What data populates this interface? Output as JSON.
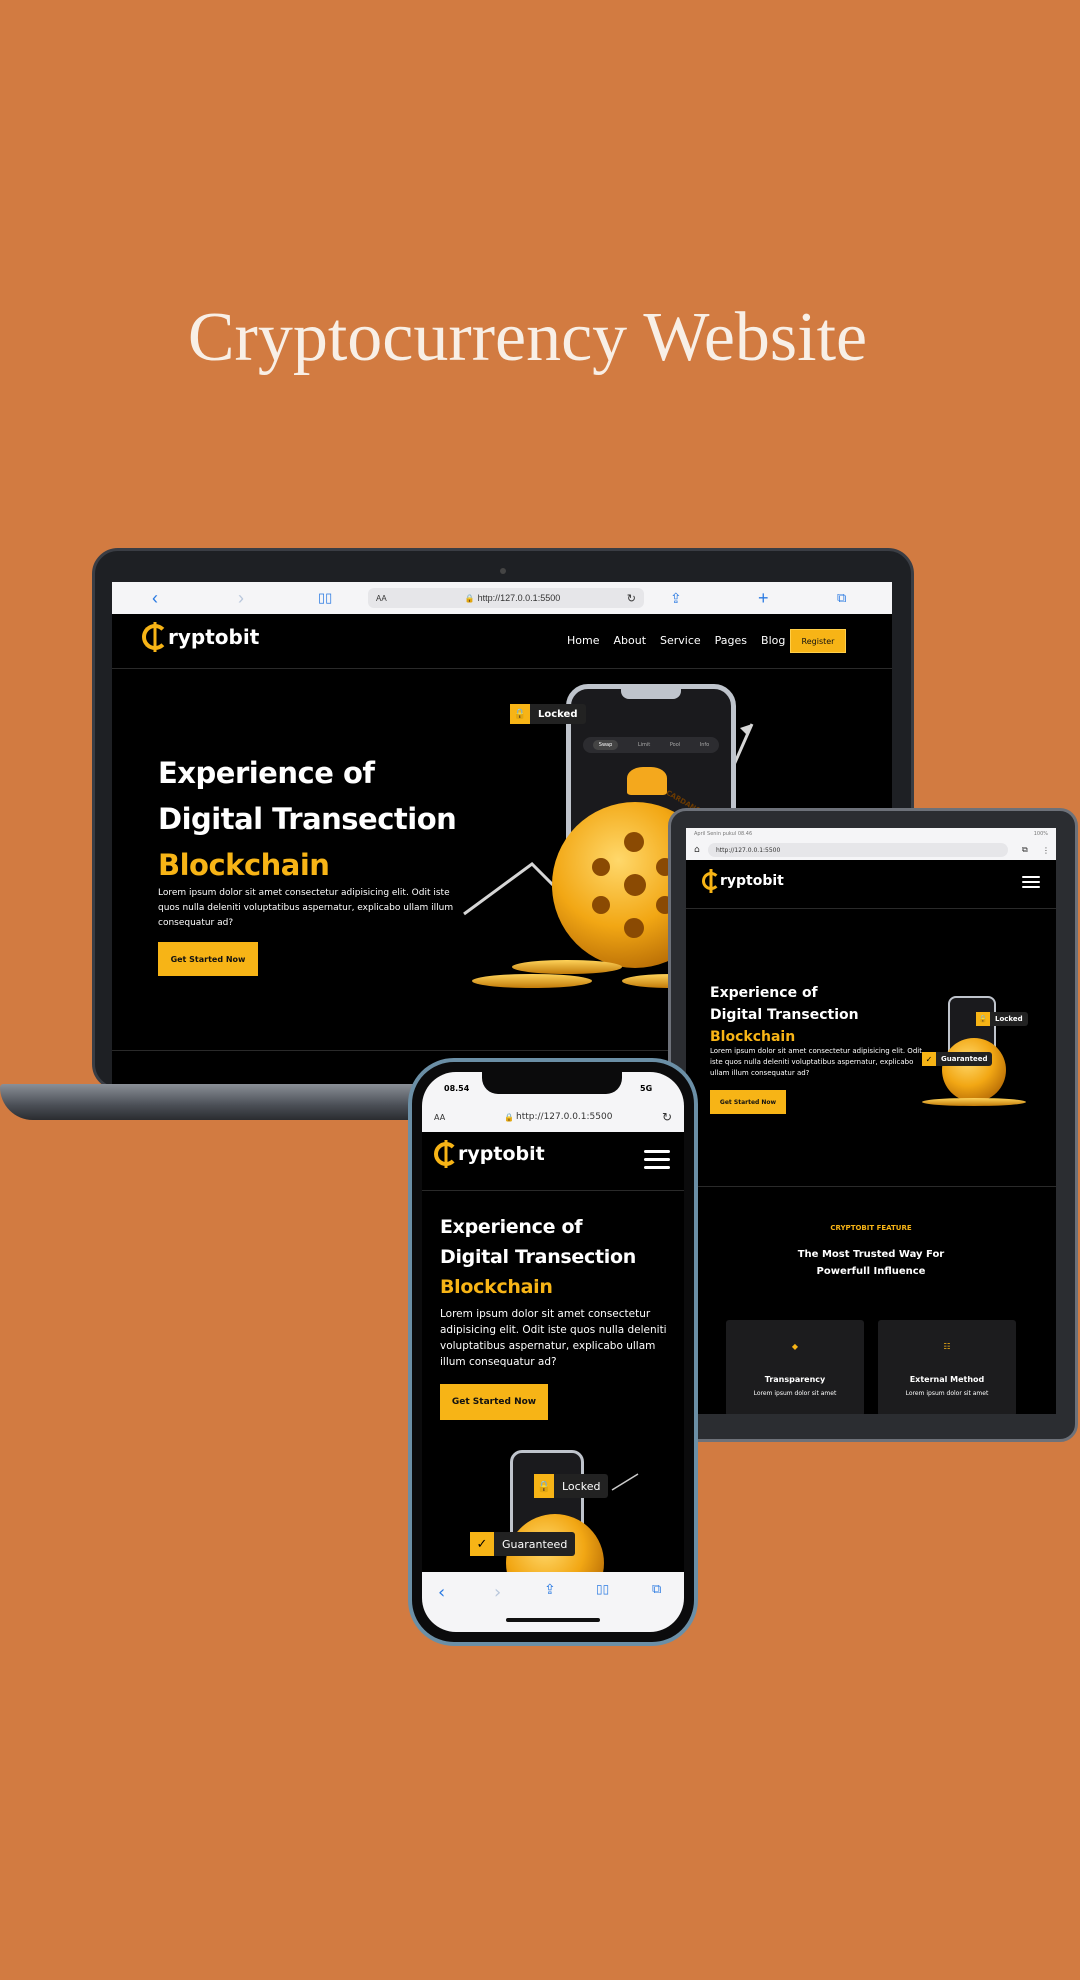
{
  "headline": "Cryptocurrency Website",
  "colors": {
    "background": "#d27b41",
    "accent": "#f7b416",
    "site_bg": "#000000"
  },
  "laptop": {
    "url": "http://127.0.0.1:5500",
    "aa": "AA",
    "nav": [
      "Home",
      "About",
      "Service",
      "Pages",
      "Blog"
    ],
    "register": "Register",
    "hero_line1": "Experience of",
    "hero_line2": "Digital Transection",
    "hero_line3": "Blockchain",
    "hero_text": "Lorem ipsum dolor sit amet consectetur adipisicing elit. Odit iste quos nulla deleniti voluptatibus aspernatur, explicabo ullam illum consequatur ad?",
    "cta": "Get Started Now",
    "locked": "Locked",
    "cardano": "CARDANO",
    "app_tabs": [
      "Swap",
      "Limit",
      "Pool",
      "Info"
    ]
  },
  "logo_text": "ryptobit",
  "tablet": {
    "status_left": "April Senin pukul 08.46",
    "status_right": "100%",
    "url": "http://127.0.0.1:5500",
    "hero_line1": "Experience of",
    "hero_line2": "Digital Transection",
    "hero_line3": "Blockchain",
    "hero_text": "Lorem ipsum dolor sit amet consectetur adipisicing elit. Odit iste quos nulla deleniti voluptatibus aspernatur, explicabo ullam illum consequatur ad?",
    "cta": "Get Started Now",
    "locked": "Locked",
    "guaranteed": "Guaranteed",
    "feature_kicker": "CRYPTOBIT FEATURE",
    "feature_title_1": "The Most Trusted Way For",
    "feature_title_2": "Powerfull Influence",
    "cards": [
      {
        "title": "Transparency",
        "text": "Lorem ipsum dolor sit amet"
      },
      {
        "title": "External Method",
        "text": "Lorem ipsum dolor sit amet"
      }
    ]
  },
  "phone": {
    "time": "08.54",
    "network": "5G",
    "aa": "AA",
    "url": "http://127.0.0.1:5500",
    "hero_line1": "Experience of",
    "hero_line2": "Digital Transection",
    "hero_line3": "Blockchain",
    "hero_text": "Lorem ipsum dolor sit amet consectetur adipisicing elit. Odit iste quos nulla deleniti voluptatibus aspernatur, explicabo ullam illum consequatur ad?",
    "cta": "Get Started Now",
    "locked": "Locked",
    "guaranteed": "Guaranteed"
  }
}
